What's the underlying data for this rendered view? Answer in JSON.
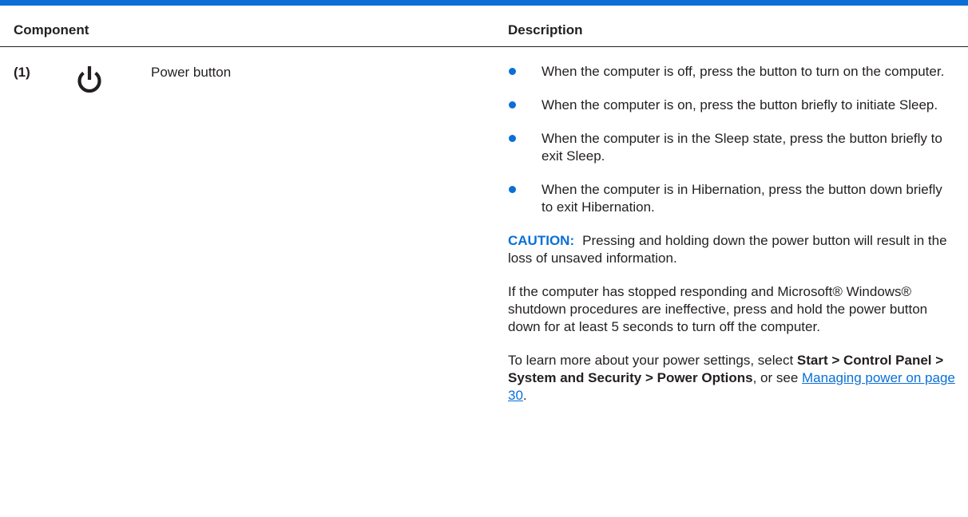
{
  "table": {
    "header": {
      "component": "Component",
      "description": "Description"
    },
    "row": {
      "number": "(1)",
      "icon": "power-icon",
      "component_name": "Power button",
      "bullets": [
        "When the computer is off, press the button to turn on the computer.",
        "When the computer is on, press the button briefly to initiate Sleep.",
        "When the computer is in the Sleep state, press the button briefly to exit Sleep.",
        "When the computer is in Hibernation, press the button down briefly to exit Hibernation."
      ],
      "caution": {
        "label": "CAUTION:",
        "text": "Pressing and holding down the power button will result in the loss of unsaved information."
      },
      "unresponsive_note": "If the computer has stopped responding and Microsoft® Windows® shutdown procedures are ineffective, press and hold the power button down for at least 5 seconds to turn off the computer.",
      "settings_note": {
        "prefix": "To learn more about your power settings, select ",
        "path": "Start > Control Panel > System and Security > Power Options",
        "middle": ", or see ",
        "link": "Managing power on page 30",
        "suffix": "."
      }
    }
  },
  "colors": {
    "accent": "#0a6fd6",
    "text": "#231f20"
  }
}
